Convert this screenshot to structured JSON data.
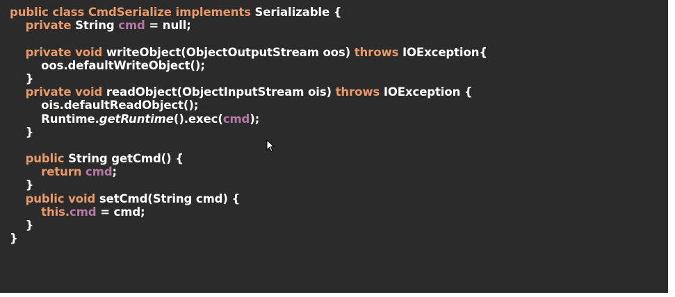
{
  "code_lines": [
    [
      {
        "t": "public class ",
        "k": "kw"
      },
      {
        "t": "CmdSerialize ",
        "k": "kw"
      },
      {
        "t": "implements ",
        "k": "kw"
      },
      {
        "t": "Serializable {",
        "k": "plain"
      }
    ],
    [
      {
        "t": "    ",
        "k": "plain"
      },
      {
        "t": "private ",
        "k": "kw"
      },
      {
        "t": "String ",
        "k": "plain"
      },
      {
        "t": "cmd",
        "k": "field"
      },
      {
        "t": " = null;",
        "k": "plain"
      }
    ],
    [
      {
        "t": "",
        "k": "plain"
      }
    ],
    [
      {
        "t": "    ",
        "k": "plain"
      },
      {
        "t": "private void ",
        "k": "kw"
      },
      {
        "t": "writeObject(ObjectOutputStream oos) ",
        "k": "plain"
      },
      {
        "t": "throws ",
        "k": "kw"
      },
      {
        "t": "IOException{",
        "k": "plain"
      }
    ],
    [
      {
        "t": "        oos.defaultWriteObject();",
        "k": "plain"
      }
    ],
    [
      {
        "t": "    }",
        "k": "plain"
      }
    ],
    [
      {
        "t": "    ",
        "k": "plain"
      },
      {
        "t": "private void ",
        "k": "kw"
      },
      {
        "t": "readObject(ObjectInputStream ois) ",
        "k": "plain"
      },
      {
        "t": "throws ",
        "k": "kw"
      },
      {
        "t": "IOException {",
        "k": "plain"
      }
    ],
    [
      {
        "t": "        ois.defaultReadObject();",
        "k": "plain"
      }
    ],
    [
      {
        "t": "        Runtime.",
        "k": "plain"
      },
      {
        "t": "getRuntime",
        "k": "italic"
      },
      {
        "t": "().exec(",
        "k": "plain"
      },
      {
        "t": "cmd",
        "k": "field"
      },
      {
        "t": ");",
        "k": "plain"
      }
    ],
    [
      {
        "t": "    }",
        "k": "plain"
      }
    ],
    [
      {
        "t": "",
        "k": "plain"
      }
    ],
    [
      {
        "t": "    ",
        "k": "plain"
      },
      {
        "t": "public ",
        "k": "kw"
      },
      {
        "t": "String ",
        "k": "plain"
      },
      {
        "t": "getCmd() {",
        "k": "plain"
      }
    ],
    [
      {
        "t": "        ",
        "k": "plain"
      },
      {
        "t": "return ",
        "k": "kw"
      },
      {
        "t": "cmd",
        "k": "field"
      },
      {
        "t": ";",
        "k": "plain"
      }
    ],
    [
      {
        "t": "    }",
        "k": "plain"
      }
    ],
    [
      {
        "t": "    ",
        "k": "plain"
      },
      {
        "t": "public void ",
        "k": "kw"
      },
      {
        "t": "setCmd(String cmd) {",
        "k": "plain"
      }
    ],
    [
      {
        "t": "        ",
        "k": "plain"
      },
      {
        "t": "this.",
        "k": "kw"
      },
      {
        "t": "cmd",
        "k": "field"
      },
      {
        "t": " = cmd;",
        "k": "plain"
      }
    ],
    [
      {
        "t": "    }",
        "k": "plain"
      }
    ],
    [
      {
        "t": "}",
        "k": "plain"
      }
    ]
  ],
  "colors": {
    "background": "#2b2b2b",
    "keyword": "#e89a6a",
    "field": "#b678a5",
    "text": "#ffffff"
  },
  "cursor_icon": "mouse-pointer-icon"
}
